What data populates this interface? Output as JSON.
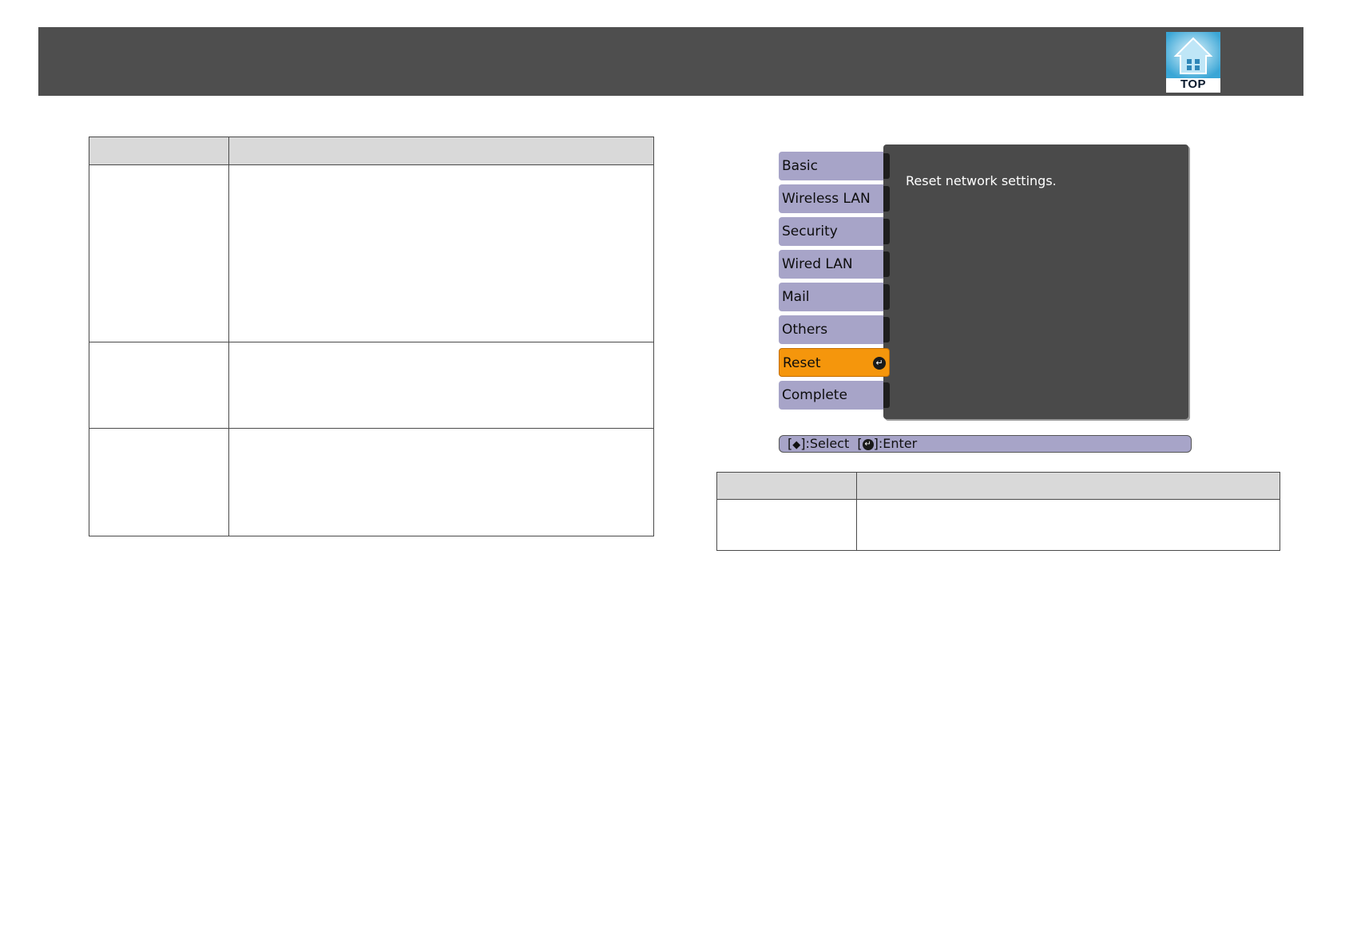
{
  "header": {
    "top_button_label": "TOP"
  },
  "projector_menu": {
    "message": "Reset network settings.",
    "items": [
      {
        "label": "Basic"
      },
      {
        "label": "Wireless LAN"
      },
      {
        "label": "Security"
      },
      {
        "label": "Wired LAN"
      },
      {
        "label": "Mail"
      },
      {
        "label": "Others"
      },
      {
        "label": "Reset",
        "selected": true
      },
      {
        "label": "Complete"
      }
    ],
    "help_bar": {
      "open_bracket": "[",
      "select_label": "]:Select",
      "open_bracket_2": "[",
      "enter_label": "]:Enter"
    },
    "colors": {
      "tab": "#a7a4c8",
      "selected_tab": "#f5960c",
      "panel": "#4a4a4a"
    }
  },
  "icons": {
    "top_button": "home-house-icon",
    "select_arrows": "up-down-arrows-icon",
    "enter": "enter-icon"
  }
}
